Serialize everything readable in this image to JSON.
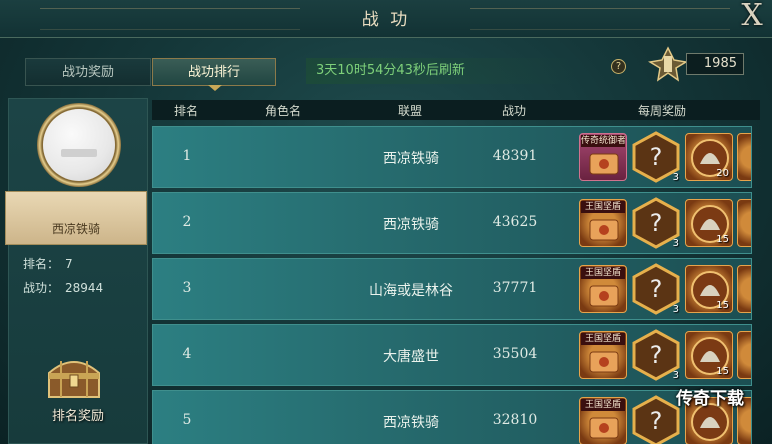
{
  "window": {
    "title": "战 功",
    "close_glyph": "X"
  },
  "tabs": [
    {
      "label": "战功奖励",
      "active": false
    },
    {
      "label": "战功排行",
      "active": true
    }
  ],
  "countdown": "3天10时54分43秒后刷新",
  "help_glyph": "?",
  "score": "1985",
  "player": {
    "name": "西凉铁骑",
    "rank_label": "排名：",
    "rank": "7",
    "merit_label": "战功：",
    "merit": "28944"
  },
  "rank_reward_label": "排名奖励",
  "table": {
    "headers": [
      "排名",
      "角色名",
      "联盟",
      "战功",
      "每周奖励"
    ],
    "rows": [
      {
        "rank": "1",
        "role": "",
        "alliance": "西凉铁骑",
        "merit": "48391",
        "item_label": "传奇统御者",
        "item_kind": "red",
        "counts": [
          "3",
          "20"
        ]
      },
      {
        "rank": "2",
        "role": "",
        "alliance": "西凉铁骑",
        "merit": "43625",
        "item_label": "王国坚盾",
        "item_kind": "gold",
        "counts": [
          "3",
          "15"
        ]
      },
      {
        "rank": "3",
        "role": "",
        "alliance": "山海或是林谷",
        "merit": "37771",
        "item_label": "王国坚盾",
        "item_kind": "gold",
        "counts": [
          "3",
          "15"
        ]
      },
      {
        "rank": "4",
        "role": "",
        "alliance": "大唐盛世",
        "merit": "35504",
        "item_label": "王国坚盾",
        "item_kind": "gold",
        "counts": [
          "3",
          "15"
        ]
      },
      {
        "rank": "5",
        "role": "",
        "alliance": "西凉铁骑",
        "merit": "32810",
        "item_label": "王国坚盾",
        "item_kind": "gold",
        "counts": [
          "",
          ""
        ]
      }
    ]
  },
  "watermark": "传奇下载"
}
